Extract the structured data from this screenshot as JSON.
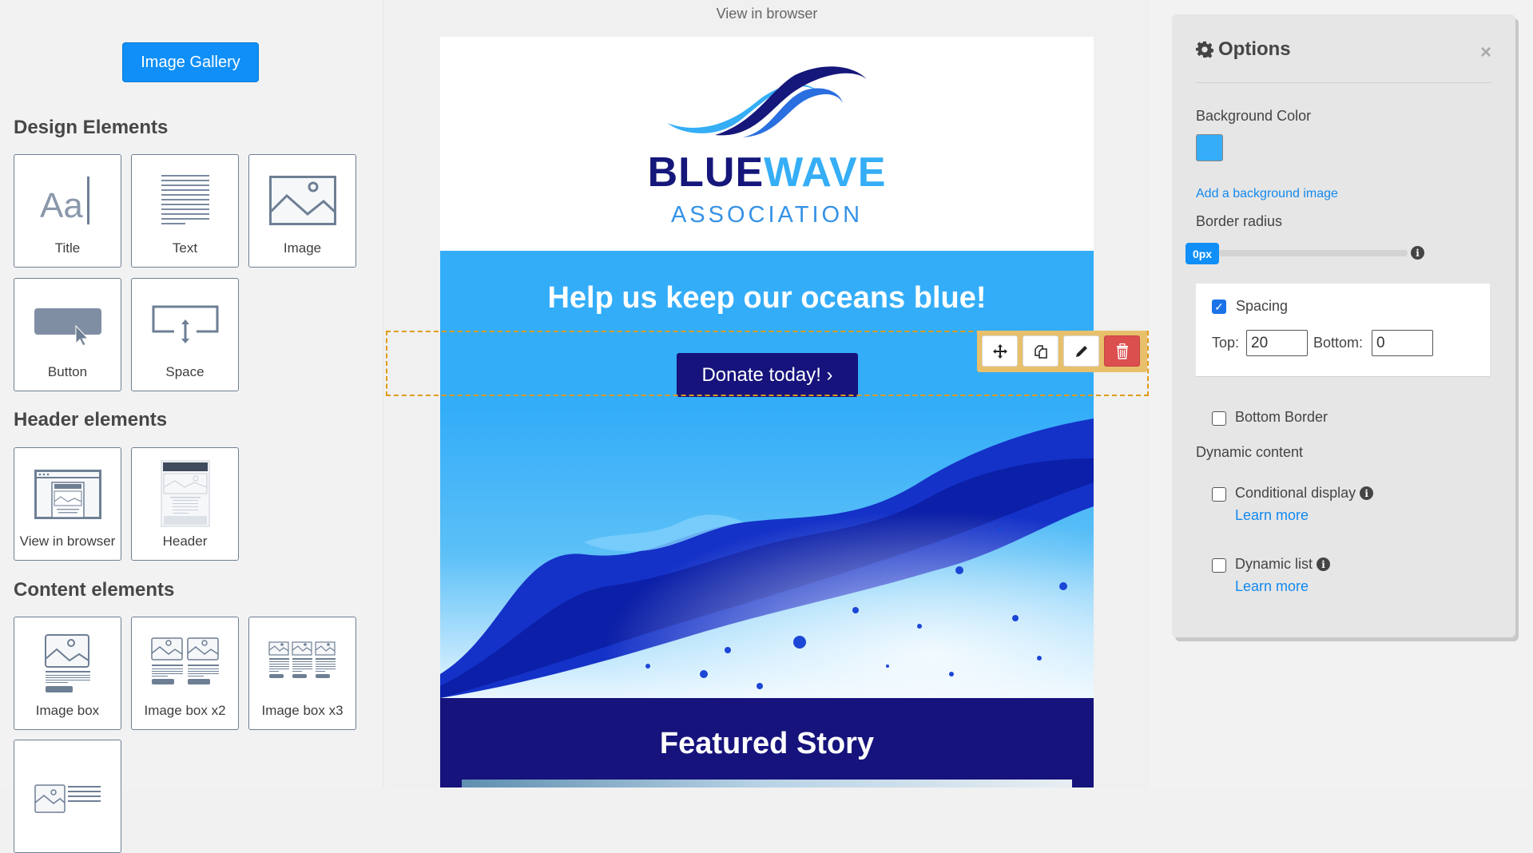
{
  "sidebar": {
    "gallery_button": "Image Gallery",
    "sections": [
      {
        "title": "Design Elements",
        "items": [
          "Title",
          "Text",
          "Image",
          "Button",
          "Space"
        ]
      },
      {
        "title": "Header elements",
        "items": [
          "View in browser",
          "Header"
        ]
      },
      {
        "title": "Content elements",
        "items": [
          "Image box",
          "Image box x2",
          "Image box x3",
          ""
        ]
      }
    ]
  },
  "canvas": {
    "view_in_browser": "View in browser",
    "logo": {
      "word_dark": "BLUE",
      "word_light": "WAVE",
      "subtitle": "ASSOCIATION"
    },
    "hero_title": "Help us keep our oceans blue!",
    "donate_button": "Donate today! ›",
    "featured_title": "Featured Story",
    "toolbar": {
      "move": "move-icon",
      "duplicate": "duplicate-icon",
      "edit": "pencil-icon",
      "delete": "trash-icon"
    }
  },
  "options": {
    "title": "Options",
    "close": "×",
    "background_color_label": "Background Color",
    "background_color": "#35adf8",
    "add_bg_image": "Add a background image",
    "border_radius_label": "Border radius",
    "border_radius_value": "0px",
    "spacing": {
      "label": "Spacing",
      "checked": true,
      "top_label": "Top:",
      "top_value": "20",
      "bottom_label": "Bottom:",
      "bottom_value": "0"
    },
    "bottom_border": {
      "label": "Bottom Border",
      "checked": false
    },
    "dynamic_content_label": "Dynamic content",
    "conditional_display": {
      "label": "Conditional display",
      "checked": false,
      "learn_more": "Learn more"
    },
    "dynamic_list": {
      "label": "Dynamic list",
      "checked": false,
      "learn_more": "Learn more"
    }
  },
  "colors": {
    "accent": "#0f8ff7",
    "navy": "#16137c",
    "sky": "#34adf8",
    "selection": "#e29a16",
    "delete": "#dc4f4f"
  }
}
